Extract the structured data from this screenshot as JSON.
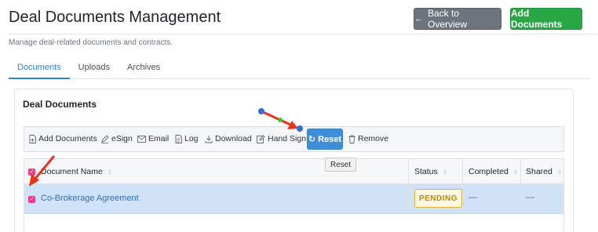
{
  "header": {
    "title": "Deal Documents Management",
    "back_label": "Back to Overview",
    "add_label": "Add Documents",
    "subtitle": "Manage deal-related documents and contracts."
  },
  "tabs": [
    {
      "label": "Documents",
      "active": true
    },
    {
      "label": "Uploads",
      "active": false
    },
    {
      "label": "Archives",
      "active": false
    }
  ],
  "card": {
    "title": "Deal Documents"
  },
  "toolbar": {
    "add_documents": "Add Documents",
    "esign": "eSign",
    "email": "Email",
    "log": "Log",
    "download": "Download",
    "hand_sign": "Hand Sign",
    "reset": "Reset",
    "remove": "Remove"
  },
  "tooltip": "Reset",
  "table": {
    "columns": [
      "Document Name",
      "Status",
      "Completed",
      "Shared"
    ],
    "rows": [
      {
        "name": "Co-Brokerage Agreement",
        "status": "PENDING",
        "completed": "—",
        "shared": "—",
        "selected": true
      }
    ]
  },
  "colors": {
    "accent": "#2f7fd0",
    "success": "#28a745",
    "secondary": "#6c757d",
    "selected_row": "#cfe2f7",
    "checkbox": "#e83e8c",
    "annotation_arrow": "#e8341c",
    "annotation_dot": "#2f6fd8"
  },
  "icons": {
    "back": "arrow-left-icon",
    "add_documents": "file-plus-icon",
    "esign": "pen-icon",
    "email": "envelope-icon",
    "log": "file-text-icon",
    "download": "download-icon",
    "hand_sign": "edit-icon",
    "reset": "refresh-icon",
    "remove": "trash-icon"
  }
}
